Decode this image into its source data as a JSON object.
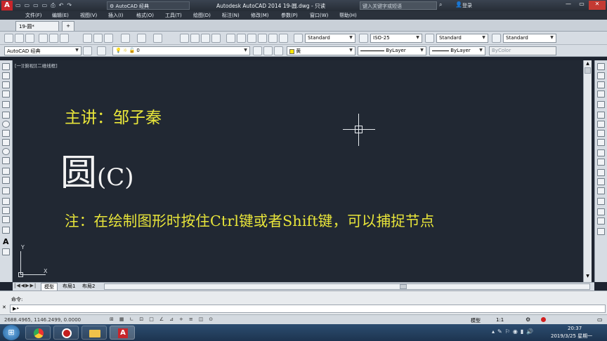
{
  "titlebar": {
    "workspace": "AutoCAD 经典",
    "title": "Autodesk AutoCAD 2014    19-圆.dwg - 只读",
    "search_placeholder": "键入关键字或短语",
    "login": "登录"
  },
  "menu": [
    "文件(F)",
    "编辑(E)",
    "视图(V)",
    "插入(I)",
    "格式(O)",
    "工具(T)",
    "绘图(D)",
    "标注(N)",
    "修改(M)",
    "参数(P)",
    "窗口(W)",
    "帮助(H)"
  ],
  "file_tab": "19-圆*",
  "styles": {
    "text_style": "Standard",
    "dim_style": "ISO-25",
    "table_style": "Standard",
    "multileader_style": "Standard"
  },
  "layers": {
    "workspace": "AutoCAD 经典",
    "layer": "0",
    "color": "黄",
    "linetype": "ByLayer",
    "lineweight": "ByLayer",
    "plotstyle": "ByColor"
  },
  "viewport_label": "[一][俯视][二维线框]",
  "canvas_text": {
    "presenter": "主讲：邹子秦",
    "topic_big": "圆",
    "topic_cmd": "(C)",
    "note": "注：在绘制图形时按住Ctrl键或者Shift键，可以捕捉节点"
  },
  "ucs": {
    "x": "X",
    "y": "Y"
  },
  "layout_tabs": [
    "模型",
    "布局1",
    "布局2"
  ],
  "command": {
    "history": "命令:",
    "prompt": ""
  },
  "status": {
    "coords": "2688.4965, 1146.2499, 0.0000",
    "model": "模型",
    "annotation_scale": "1:1"
  },
  "clock": {
    "time": "20:37",
    "date": "2019/3/25 星期一"
  },
  "colors": {
    "accent_yellow": "#e8e53a",
    "canvas": "#212833",
    "taskbar": "#1d3450"
  }
}
